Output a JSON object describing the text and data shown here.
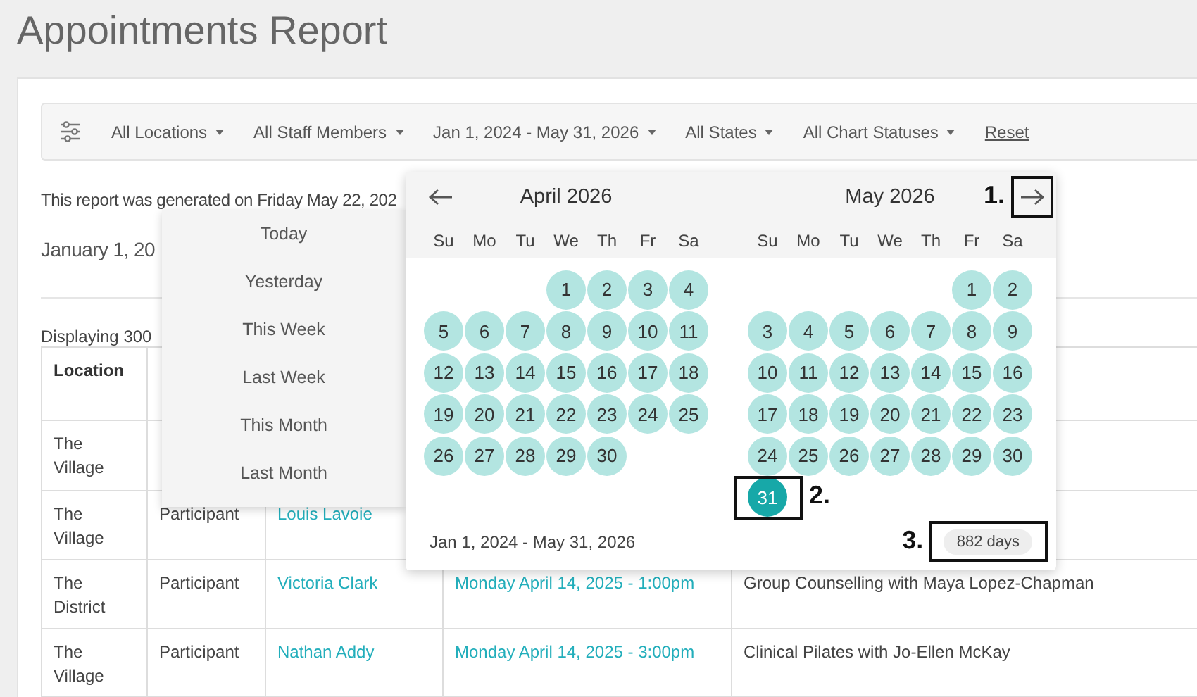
{
  "page": {
    "title": "Appointments Report"
  },
  "filters": [
    {
      "label": "All Locations",
      "kind": "dropdown"
    },
    {
      "label": "All Staff Members",
      "kind": "dropdown"
    },
    {
      "label": "Jan 1, 2024 - May 31, 2026",
      "kind": "dropdown"
    },
    {
      "label": "All States",
      "kind": "dropdown"
    },
    {
      "label": "All Chart Statuses",
      "kind": "dropdown"
    },
    {
      "label": "Reset",
      "kind": "link"
    }
  ],
  "report": {
    "generated_text": "This report was generated on Friday May 22, 202",
    "heading": "January 1, 20",
    "count_text": "Displaying 300"
  },
  "table": {
    "columns": [
      {
        "label": "Location"
      }
    ],
    "rows": [
      {
        "cells": [
          {
            "text": "The Village",
            "kind": "text"
          }
        ]
      },
      {
        "cells": [
          {
            "text": "The Village",
            "kind": "text"
          },
          {
            "text": "Participant",
            "kind": "text"
          },
          {
            "text": "Louis Lavoie",
            "kind": "link"
          }
        ]
      },
      {
        "cells": [
          {
            "text": "The District",
            "kind": "text"
          },
          {
            "text": "Participant",
            "kind": "text"
          },
          {
            "text": "Victoria Clark",
            "kind": "link"
          },
          {
            "text": "Monday April 14, 2025 - 1:00pm",
            "kind": "link"
          },
          {
            "text": "Group Counselling with Maya Lopez-Chapman",
            "kind": "text"
          }
        ]
      },
      {
        "cells": [
          {
            "text": "The Village",
            "kind": "text"
          },
          {
            "text": "Participant",
            "kind": "text"
          },
          {
            "text": "Nathan Addy",
            "kind": "link"
          },
          {
            "text": "Monday April 14, 2025 - 3:00pm",
            "kind": "link"
          },
          {
            "text": "Clinical Pilates with Jo-Ellen McKay",
            "kind": "text"
          }
        ]
      }
    ]
  },
  "presets": [
    {
      "label": "Today"
    },
    {
      "label": "Yesterday"
    },
    {
      "label": "This Week"
    },
    {
      "label": "Last Week"
    },
    {
      "label": "This Month"
    },
    {
      "label": "Last Month"
    }
  ],
  "calendar": {
    "next_annotation": "1.",
    "months": [
      {
        "title": "April 2026",
        "weekdays": [
          "Su",
          "Mo",
          "Tu",
          "We",
          "Th",
          "Fr",
          "Sa"
        ],
        "weeks": [
          [
            {
              "kind": "blank"
            },
            {
              "kind": "blank"
            },
            {
              "kind": "blank"
            },
            {
              "kind": "day",
              "day": "1",
              "selected": false
            },
            {
              "kind": "day",
              "day": "2",
              "selected": false
            },
            {
              "kind": "day",
              "day": "3",
              "selected": false
            },
            {
              "kind": "day",
              "day": "4",
              "selected": false
            }
          ],
          [
            {
              "kind": "day",
              "day": "5",
              "selected": false
            },
            {
              "kind": "day",
              "day": "6",
              "selected": false
            },
            {
              "kind": "day",
              "day": "7",
              "selected": false
            },
            {
              "kind": "day",
              "day": "8",
              "selected": false
            },
            {
              "kind": "day",
              "day": "9",
              "selected": false
            },
            {
              "kind": "day",
              "day": "10",
              "selected": false
            },
            {
              "kind": "day",
              "day": "11",
              "selected": false
            }
          ],
          [
            {
              "kind": "day",
              "day": "12",
              "selected": false
            },
            {
              "kind": "day",
              "day": "13",
              "selected": false
            },
            {
              "kind": "day",
              "day": "14",
              "selected": false
            },
            {
              "kind": "day",
              "day": "15",
              "selected": false
            },
            {
              "kind": "day",
              "day": "16",
              "selected": false
            },
            {
              "kind": "day",
              "day": "17",
              "selected": false
            },
            {
              "kind": "day",
              "day": "18",
              "selected": false
            }
          ],
          [
            {
              "kind": "day",
              "day": "19",
              "selected": false
            },
            {
              "kind": "day",
              "day": "20",
              "selected": false
            },
            {
              "kind": "day",
              "day": "21",
              "selected": false
            },
            {
              "kind": "day",
              "day": "22",
              "selected": false
            },
            {
              "kind": "day",
              "day": "23",
              "selected": false
            },
            {
              "kind": "day",
              "day": "24",
              "selected": false
            },
            {
              "kind": "day",
              "day": "25",
              "selected": false
            }
          ],
          [
            {
              "kind": "day",
              "day": "26",
              "selected": false
            },
            {
              "kind": "day",
              "day": "27",
              "selected": false
            },
            {
              "kind": "day",
              "day": "28",
              "selected": false
            },
            {
              "kind": "day",
              "day": "29",
              "selected": false
            },
            {
              "kind": "day",
              "day": "30",
              "selected": false
            }
          ]
        ]
      },
      {
        "title": "May 2026",
        "weekdays": [
          "Su",
          "Mo",
          "Tu",
          "We",
          "Th",
          "Fr",
          "Sa"
        ],
        "weeks": [
          [
            {
              "kind": "blank"
            },
            {
              "kind": "blank"
            },
            {
              "kind": "blank"
            },
            {
              "kind": "blank"
            },
            {
              "kind": "blank"
            },
            {
              "kind": "day",
              "day": "1",
              "selected": false
            },
            {
              "kind": "day",
              "day": "2",
              "selected": false
            }
          ],
          [
            {
              "kind": "day",
              "day": "3",
              "selected": false
            },
            {
              "kind": "day",
              "day": "4",
              "selected": false
            },
            {
              "kind": "day",
              "day": "5",
              "selected": false
            },
            {
              "kind": "day",
              "day": "6",
              "selected": false
            },
            {
              "kind": "day",
              "day": "7",
              "selected": false
            },
            {
              "kind": "day",
              "day": "8",
              "selected": false
            },
            {
              "kind": "day",
              "day": "9",
              "selected": false
            }
          ],
          [
            {
              "kind": "day",
              "day": "10",
              "selected": false
            },
            {
              "kind": "day",
              "day": "11",
              "selected": false
            },
            {
              "kind": "day",
              "day": "12",
              "selected": false
            },
            {
              "kind": "day",
              "day": "13",
              "selected": false
            },
            {
              "kind": "day",
              "day": "14",
              "selected": false
            },
            {
              "kind": "day",
              "day": "15",
              "selected": false
            },
            {
              "kind": "day",
              "day": "16",
              "selected": false
            }
          ],
          [
            {
              "kind": "day",
              "day": "17",
              "selected": false
            },
            {
              "kind": "day",
              "day": "18",
              "selected": false
            },
            {
              "kind": "day",
              "day": "19",
              "selected": false
            },
            {
              "kind": "day",
              "day": "20",
              "selected": false
            },
            {
              "kind": "day",
              "day": "21",
              "selected": false
            },
            {
              "kind": "day",
              "day": "22",
              "selected": false
            },
            {
              "kind": "day",
              "day": "23",
              "selected": false
            }
          ],
          [
            {
              "kind": "day",
              "day": "24",
              "selected": false
            },
            {
              "kind": "day",
              "day": "25",
              "selected": false
            },
            {
              "kind": "day",
              "day": "26",
              "selected": false
            },
            {
              "kind": "day",
              "day": "27",
              "selected": false
            },
            {
              "kind": "day",
              "day": "28",
              "selected": false
            },
            {
              "kind": "day",
              "day": "29",
              "selected": false
            },
            {
              "kind": "day",
              "day": "30",
              "selected": false
            }
          ],
          [
            {
              "kind": "day",
              "day": "31",
              "selected": true,
              "annotation": "2."
            }
          ]
        ]
      }
    ],
    "range_text": "Jan 1, 2024 - May 31, 2026",
    "days_count": {
      "text": "882 days",
      "annotation": "3."
    }
  }
}
